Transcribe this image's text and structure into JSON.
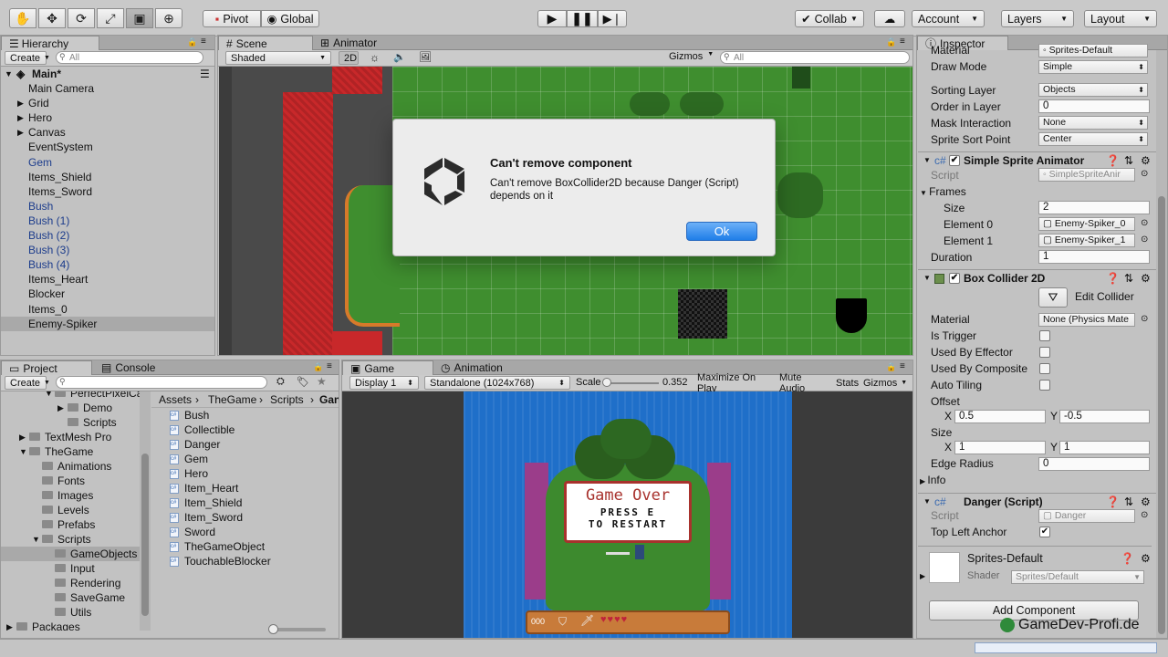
{
  "toolbar": {
    "pivot": "Pivot",
    "global": "Global",
    "collab": "Collab",
    "account": "Account",
    "layers": "Layers",
    "layout": "Layout",
    "tools": [
      "hand-icon",
      "move-icon",
      "rotate-icon",
      "scale-icon",
      "rect-icon",
      "transform-icon"
    ]
  },
  "hierarchy": {
    "tab": "Hierarchy",
    "create": "Create",
    "search": "All",
    "scene": "Main*",
    "items": [
      {
        "label": "Main Camera",
        "prefab": false,
        "arrow": false
      },
      {
        "label": "Grid",
        "prefab": false,
        "arrow": true
      },
      {
        "label": "Hero",
        "prefab": false,
        "arrow": true
      },
      {
        "label": "Canvas",
        "prefab": false,
        "arrow": true
      },
      {
        "label": "EventSystem",
        "prefab": false,
        "arrow": false
      },
      {
        "label": "Gem",
        "prefab": true,
        "arrow": false
      },
      {
        "label": "Items_Shield",
        "prefab": false,
        "arrow": false
      },
      {
        "label": "Items_Sword",
        "prefab": false,
        "arrow": false
      },
      {
        "label": "Bush",
        "prefab": true,
        "arrow": false
      },
      {
        "label": "Bush (1)",
        "prefab": true,
        "arrow": false
      },
      {
        "label": "Bush (2)",
        "prefab": true,
        "arrow": false
      },
      {
        "label": "Bush (3)",
        "prefab": true,
        "arrow": false
      },
      {
        "label": "Bush (4)",
        "prefab": true,
        "arrow": false
      },
      {
        "label": "Items_Heart",
        "prefab": false,
        "arrow": false
      },
      {
        "label": "Blocker",
        "prefab": false,
        "arrow": false
      },
      {
        "label": "Items_0",
        "prefab": false,
        "arrow": false
      },
      {
        "label": "Enemy-Spiker",
        "prefab": false,
        "arrow": false,
        "selected": true
      }
    ]
  },
  "scene": {
    "tab_scene": "Scene",
    "tab_animator": "Animator",
    "shaded": "Shaded",
    "mode2d": "2D",
    "gizmos": "Gizmos",
    "search": "All"
  },
  "dialog": {
    "title": "Can't remove component",
    "message": "Can't remove BoxCollider2D because Danger (Script) depends on it",
    "ok": "Ok"
  },
  "project": {
    "tab_project": "Project",
    "tab_console": "Console",
    "create": "Create",
    "tree": [
      {
        "label": "PerfectPixelCame",
        "indent": 3,
        "arrow": "open"
      },
      {
        "label": "Demo",
        "indent": 4,
        "arrow": "closed"
      },
      {
        "label": "Scripts",
        "indent": 4,
        "arrow": "none"
      },
      {
        "label": "TextMesh Pro",
        "indent": 1,
        "arrow": "closed"
      },
      {
        "label": "TheGame",
        "indent": 1,
        "arrow": "open"
      },
      {
        "label": "Animations",
        "indent": 2,
        "arrow": "none"
      },
      {
        "label": "Fonts",
        "indent": 2,
        "arrow": "none"
      },
      {
        "label": "Images",
        "indent": 2,
        "arrow": "none"
      },
      {
        "label": "Levels",
        "indent": 2,
        "arrow": "none"
      },
      {
        "label": "Prefabs",
        "indent": 2,
        "arrow": "none"
      },
      {
        "label": "Scripts",
        "indent": 2,
        "arrow": "open"
      },
      {
        "label": "GameObjects",
        "indent": 3,
        "arrow": "none",
        "selected": true
      },
      {
        "label": "Input",
        "indent": 3,
        "arrow": "none"
      },
      {
        "label": "Rendering",
        "indent": 3,
        "arrow": "none"
      },
      {
        "label": "SaveGame",
        "indent": 3,
        "arrow": "none"
      },
      {
        "label": "Utils",
        "indent": 3,
        "arrow": "none"
      },
      {
        "label": "Packages",
        "indent": 0,
        "arrow": "closed"
      }
    ],
    "breadcrumb": [
      "Assets",
      "TheGame",
      "Scripts",
      "Gan"
    ],
    "files": [
      "Bush",
      "Collectible",
      "Danger",
      "Gem",
      "Hero",
      "Item_Heart",
      "Item_Shield",
      "Item_Sword",
      "Sword",
      "TheGameObject",
      "TouchableBlocker"
    ]
  },
  "game": {
    "tab_game": "Game",
    "tab_animation": "Animation",
    "display": "Display 1",
    "resolution": "Standalone (1024x768)",
    "scale_label": "Scale",
    "scale_value": "0.352",
    "maximize": "Maximize On Play",
    "mute": "Mute Audio",
    "stats": "Stats",
    "gizmos": "Gizmos",
    "over_title": "Game Over",
    "over_line1": "PRESS E",
    "over_line2": "TO RESTART",
    "hud_count": "000",
    "scale_level": 0.05
  },
  "inspector": {
    "tab": "Inspector",
    "sprite_renderer": {
      "material_label": "Material",
      "material_value": "Sprites-Default",
      "draw_mode_label": "Draw Mode",
      "draw_mode_value": "Simple",
      "sorting_layer_label": "Sorting Layer",
      "sorting_layer_value": "Objects",
      "order_label": "Order in Layer",
      "order_value": "0",
      "mask_label": "Mask Interaction",
      "mask_value": "None",
      "sort_point_label": "Sprite Sort Point",
      "sort_point_value": "Center"
    },
    "animator": {
      "title": "Simple Sprite Animator",
      "script_label": "Script",
      "script_value": "SimpleSpriteAnir",
      "frames_label": "Frames",
      "size_label": "Size",
      "size_value": "2",
      "e0_label": "Element 0",
      "e0_value": "Enemy-Spiker_0",
      "e1_label": "Element 1",
      "e1_value": "Enemy-Spiker_1",
      "duration_label": "Duration",
      "duration_value": "1"
    },
    "collider": {
      "title": "Box Collider 2D",
      "edit": "Edit Collider",
      "material_label": "Material",
      "material_value": "None (Physics Mate",
      "trigger_label": "Is Trigger",
      "effector_label": "Used By Effector",
      "composite_label": "Used By Composite",
      "tiling_label": "Auto Tiling",
      "offset_label": "Offset",
      "offset_x": "0.5",
      "offset_y": "-0.5",
      "size_label": "Size",
      "size_x": "1",
      "size_y": "1",
      "edge_label": "Edge Radius",
      "edge_value": "0",
      "info_label": "Info",
      "x": "X",
      "y": "Y"
    },
    "danger": {
      "title": "Danger (Script)",
      "script_label": "Script",
      "script_value": "Danger",
      "anchor_label": "Top Left Anchor"
    },
    "material": {
      "title": "Sprites-Default",
      "shader_label": "Shader",
      "shader_value": "Sprites/Default"
    },
    "add_component": "Add Component"
  },
  "watermark": "GameDev-Profi.de"
}
